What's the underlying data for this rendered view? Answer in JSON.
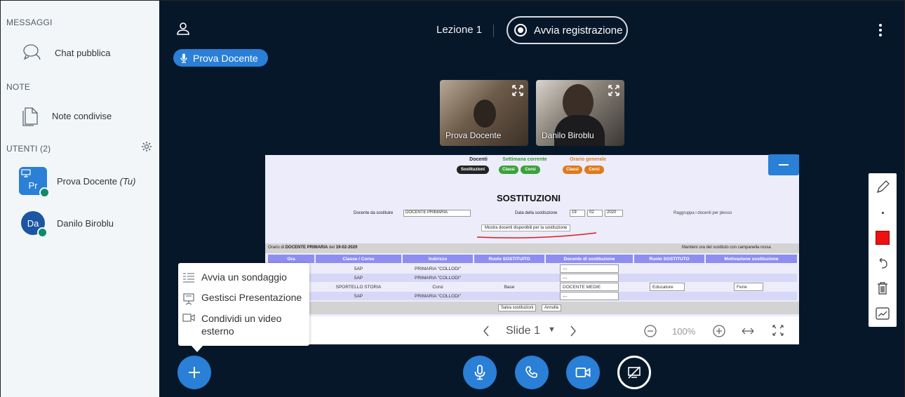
{
  "sidebar": {
    "messages_title": "MESSAGGI",
    "public_chat": "Chat pubblica",
    "notes_title": "NOTE",
    "shared_notes": "Note condivise",
    "users_title": "UTENTI (2)",
    "users": [
      {
        "initials": "Pr",
        "name": "Prova Docente",
        "you": "(Tu)"
      },
      {
        "initials": "Da",
        "name": "Danilo Biroblu"
      }
    ]
  },
  "topbar": {
    "title": "Lezione 1",
    "record_label": "Avvia registrazione"
  },
  "talker": {
    "name": "Prova Docente"
  },
  "videos": [
    {
      "name": "Prova Docente"
    },
    {
      "name": "Danilo Biroblu"
    }
  ],
  "slide": {
    "groups": [
      {
        "title": "Docenti",
        "buttons": [
          "Sostituzioni"
        ]
      },
      {
        "title": "Settimana corrente",
        "buttons": [
          "Classi",
          "Corsi"
        ]
      },
      {
        "title": "Orario generale",
        "buttons": [
          "Classi",
          "Corsi"
        ]
      }
    ],
    "heading": "SOSTITUZIONI",
    "teacher_label": "Docente da sostituire",
    "teacher_value": "DOCENTE PRIMARIA",
    "date_label": "Data della sostituzione",
    "date_day": "19",
    "date_month": "02",
    "date_year": "2020",
    "group_label": "Raggruppa i docenti per plesso",
    "show_button": "Mostra docenti disponibili per la sostituzione",
    "schedule_prefix": "Orario di",
    "schedule_teacher": "DOCENTE PRIMARIA",
    "schedule_del": "del",
    "schedule_date": "19-02-2020",
    "keep_label": "Mantieni ora del sostituto con campanella rossa",
    "columns": [
      "Ora",
      "Classe / Corso",
      "Indirizzo",
      "Ruolo SOSTITUITO",
      "Docente di sostituzione",
      "Ruolo SOSTITUTO",
      "Motivazione sostituzione"
    ],
    "rows": [
      {
        "classe": "5AP",
        "indirizzo": "PRIMARIA \"COLLODI\"",
        "ruolo": "",
        "docente": "---",
        "sostituto": "",
        "motivo": ""
      },
      {
        "classe": "5AP",
        "indirizzo": "PRIMARIA \"COLLODI\"",
        "ruolo": "",
        "docente": "---",
        "sostituto": "",
        "motivo": ""
      },
      {
        "classe": "SPORTELLO STORIA",
        "indirizzo": "Corsi",
        "ruolo": "Base",
        "docente": "DOCENTE MEDIE",
        "sostituto": "Educatore",
        "motivo": "Ferie"
      },
      {
        "classe": "5AP",
        "indirizzo": "PRIMARIA \"COLLODI\"",
        "ruolo": "",
        "docente": "---",
        "sostituto": "",
        "motivo": ""
      }
    ],
    "save_button": "Salva sostituzioni",
    "cancel_button": "Annulla"
  },
  "slide_nav": {
    "slide_label": "Slide 1",
    "zoom": "100%"
  },
  "menu": {
    "items": [
      "Avvia un sondaggio",
      "Gestisci Presentazione",
      "Condividi un video esterno"
    ]
  },
  "colors": {
    "accent": "#2a7fd6",
    "main_bg": "#07172a",
    "sidebar_bg": "#f3f6f9",
    "draw_color": "#ee1111",
    "mic_green": "#0f8a6a"
  }
}
